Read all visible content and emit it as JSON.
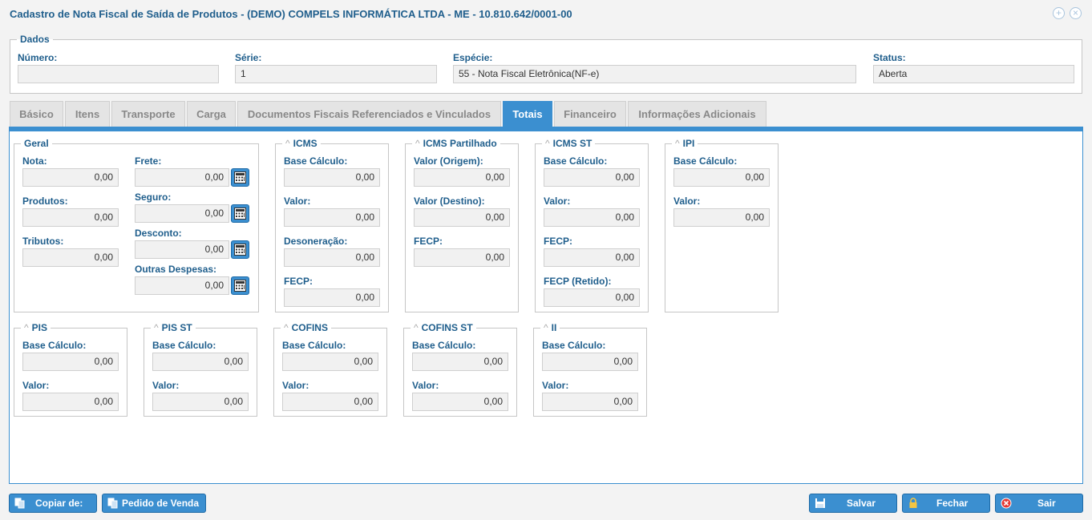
{
  "window": {
    "title": "Cadastro de Nota Fiscal de Saída de Produtos - (DEMO) COMPELS INFORMÁTICA LTDA - ME - 10.810.642/0001-00",
    "add_icon": "+",
    "close_icon": "×"
  },
  "dados": {
    "legend": "Dados",
    "numero_label": "Número:",
    "numero_value": "",
    "serie_label": "Série:",
    "serie_value": "1",
    "especie_label": "Espécie:",
    "especie_value": "55 - Nota Fiscal Eletrônica(NF-e)",
    "status_label": "Status:",
    "status_value": "Aberta"
  },
  "tabs": [
    "Básico",
    "Itens",
    "Transporte",
    "Carga",
    "Documentos Fiscais Referenciados e Vinculados",
    "Totais",
    "Financeiro",
    "Informações Adicionais"
  ],
  "active_tab": "Totais",
  "geral": {
    "legend": "Geral",
    "nota_label": "Nota:",
    "nota_value": "0,00",
    "produtos_label": "Produtos:",
    "produtos_value": "0,00",
    "tributos_label": "Tributos:",
    "tributos_value": "0,00",
    "frete_label": "Frete:",
    "frete_value": "0,00",
    "seguro_label": "Seguro:",
    "seguro_value": "0,00",
    "desconto_label": "Desconto:",
    "desconto_value": "0,00",
    "outras_label": "Outras Despesas:",
    "outras_value": "0,00"
  },
  "icms": {
    "legend": "ICMS",
    "base_label": "Base Cálculo:",
    "base_value": "0,00",
    "valor_label": "Valor:",
    "valor_value": "0,00",
    "deson_label": "Desoneração:",
    "deson_value": "0,00",
    "fecp_label": "FECP:",
    "fecp_value": "0,00"
  },
  "icms_partilhado": {
    "legend": "ICMS Partilhado",
    "origem_label": "Valor (Origem):",
    "origem_value": "0,00",
    "destino_label": "Valor (Destino):",
    "destino_value": "0,00",
    "fecp_label": "FECP:",
    "fecp_value": "0,00"
  },
  "icms_st": {
    "legend": "ICMS ST",
    "base_label": "Base Cálculo:",
    "base_value": "0,00",
    "valor_label": "Valor:",
    "valor_value": "0,00",
    "fecp_label": "FECP:",
    "fecp_value": "0,00",
    "fecp_retido_label": "FECP (Retido):",
    "fecp_retido_value": "0,00"
  },
  "ipi": {
    "legend": "IPI",
    "base_label": "Base Cálculo:",
    "base_value": "0,00",
    "valor_label": "Valor:",
    "valor_value": "0,00"
  },
  "pis": {
    "legend": "PIS",
    "base_label": "Base Cálculo:",
    "base_value": "0,00",
    "valor_label": "Valor:",
    "valor_value": "0,00"
  },
  "pis_st": {
    "legend": "PIS ST",
    "base_label": "Base Cálculo:",
    "base_value": "0,00",
    "valor_label": "Valor:",
    "valor_value": "0,00"
  },
  "cofins": {
    "legend": "COFINS",
    "base_label": "Base Cálculo:",
    "base_value": "0,00",
    "valor_label": "Valor:",
    "valor_value": "0,00"
  },
  "cofins_st": {
    "legend": "COFINS ST",
    "base_label": "Base Cálculo:",
    "base_value": "0,00",
    "valor_label": "Valor:",
    "valor_value": "0,00"
  },
  "ii": {
    "legend": "II",
    "base_label": "Base Cálculo:",
    "base_value": "0,00",
    "valor_label": "Valor:",
    "valor_value": "0,00"
  },
  "footer": {
    "copiar_label": "Copiar de:",
    "pedido_label": "Pedido de Venda",
    "salvar_label": "Salvar",
    "fechar_label": "Fechar",
    "sair_label": "Sair"
  },
  "colors": {
    "accent": "#3b8fd0",
    "label": "#1f5e8c"
  }
}
